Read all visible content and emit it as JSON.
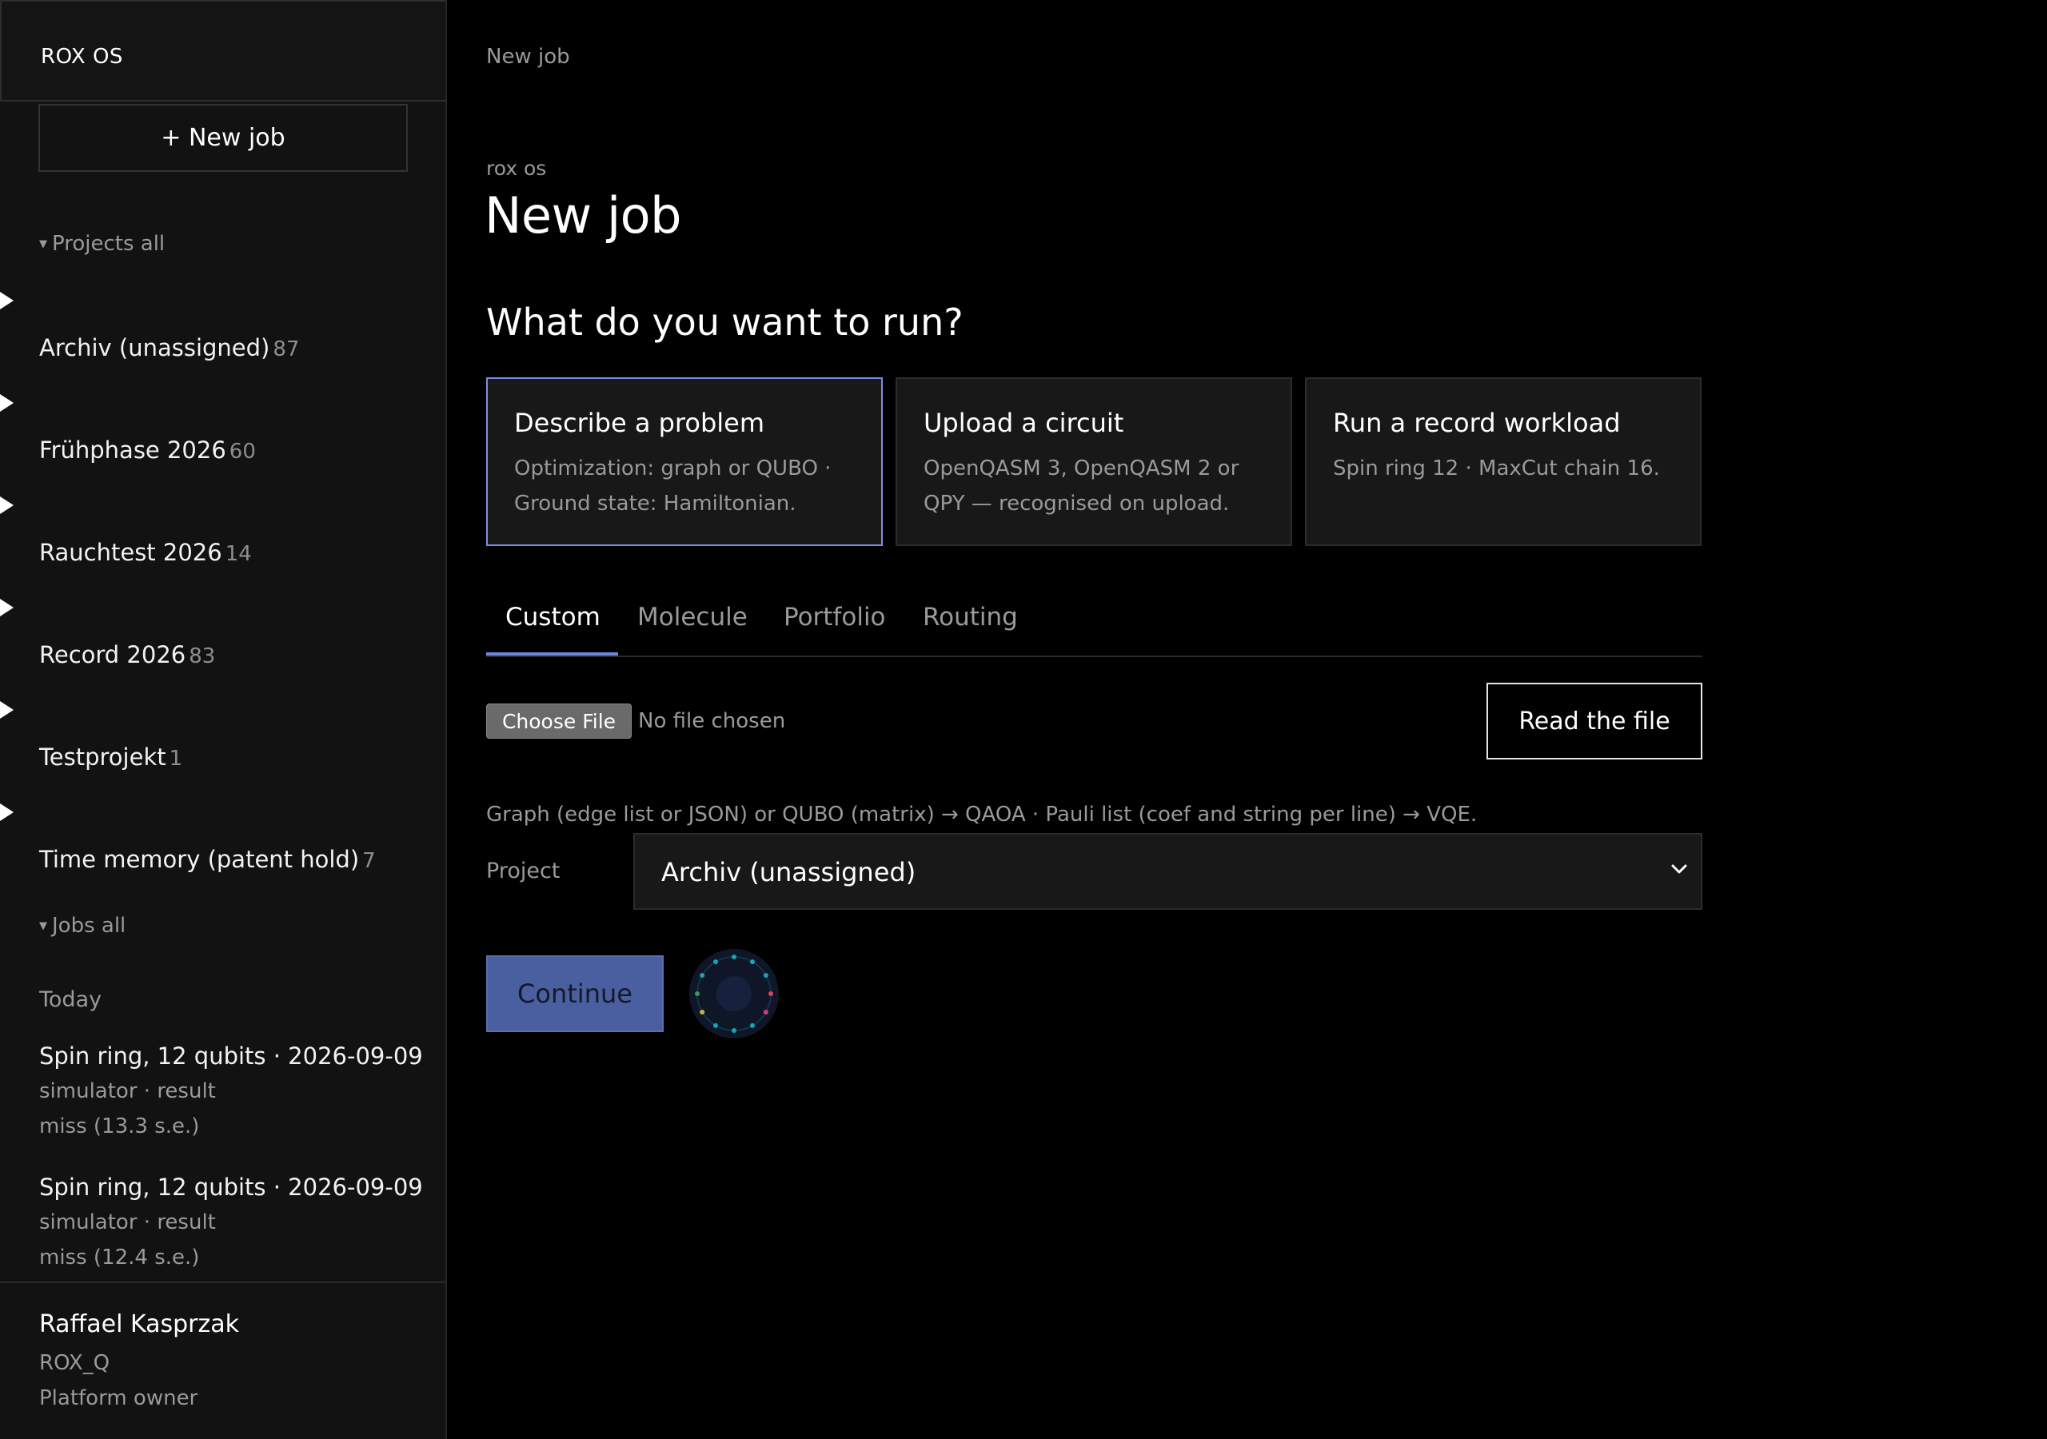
{
  "sidebar": {
    "brand": "ROX OS",
    "new_job_label": "+ New job",
    "projects_toggle": "Projects all",
    "projects": [
      {
        "name": "Archiv (unassigned)",
        "count": "87"
      },
      {
        "name": "Frühphase 2026",
        "count": "60"
      },
      {
        "name": "Rauchtest 2026",
        "count": "14"
      },
      {
        "name": "Record 2026",
        "count": "83"
      },
      {
        "name": "Testprojekt",
        "count": "1"
      },
      {
        "name": "Time memory (patent hold)",
        "count": "7"
      }
    ],
    "jobs_toggle": "Jobs all",
    "jobs_group": "Today",
    "jobs": [
      {
        "title": "Spin ring, 12 qubits · 2026-09-09",
        "line1": "simulator · result",
        "line2": "miss (13.3 s.e.)"
      },
      {
        "title": "Spin ring, 12 qubits · 2026-09-09",
        "line1": "simulator · result",
        "line2": "miss (12.4 s.e.)"
      }
    ],
    "user": {
      "name": "Raffael Kasprzak",
      "org": "ROX_Q",
      "role": "Platform owner"
    }
  },
  "main": {
    "breadcrumb": "New job",
    "eyebrow": "rox os",
    "title": "New job",
    "question": "What do you want to run?",
    "cards": [
      {
        "title": "Describe a problem",
        "desc": "Optimization: graph or QUBO · Ground state: Hamiltonian.",
        "selected": true
      },
      {
        "title": "Upload a circuit",
        "desc": "OpenQASM 3, OpenQASM 2 or QPY — recognised on upload.",
        "selected": false
      },
      {
        "title": "Run a record workload",
        "desc": "Spin ring 12 · MaxCut chain 16.",
        "selected": false
      }
    ],
    "tabs": [
      "Custom",
      "Molecule",
      "Portfolio",
      "Routing"
    ],
    "active_tab": "Custom",
    "file": {
      "choose_label": "Choose File",
      "status": "No file chosen",
      "read_label": "Read the file"
    },
    "hint": "Graph (edge list or JSON) or QUBO (matrix) → QAOA · Pauli list (coef and string per line) → VQE.",
    "project_label": "Project",
    "project_value": "Archiv (unassigned)",
    "continue_label": "Continue"
  },
  "colors": {
    "accent": "#7a8fe0",
    "continue_bg": "#4a5f9f",
    "background": "#000000",
    "sidebar_bg": "#121212"
  }
}
